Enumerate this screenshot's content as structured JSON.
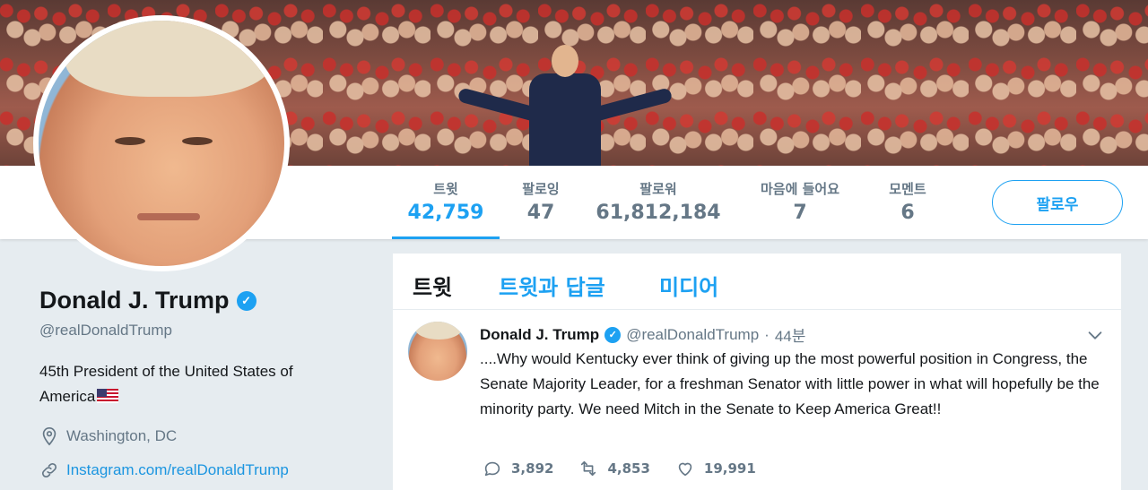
{
  "profile": {
    "name": "Donald J. Trump",
    "handle": "@realDonaldTrump",
    "bio": "45th President of the United States of America",
    "location": "Washington, DC",
    "link": "Instagram.com/realDonaldTrump",
    "verified_mark": "✓"
  },
  "nav": {
    "stats": [
      {
        "label": "트윗",
        "value": "42,759"
      },
      {
        "label": "팔로잉",
        "value": "47"
      },
      {
        "label": "팔로워",
        "value": "61,812,184"
      },
      {
        "label": "마음에 들어요",
        "value": "7"
      },
      {
        "label": "모멘트",
        "value": "6"
      }
    ],
    "follow_label": "팔로우"
  },
  "timeline": {
    "tabs": [
      {
        "label": "트윗"
      },
      {
        "label": "트윗과 답글"
      },
      {
        "label": "미디어"
      }
    ]
  },
  "tweet": {
    "name": "Donald J. Trump",
    "handle": "@realDonaldTrump",
    "separator": "·",
    "time": "44분",
    "text": "....Why would Kentucky ever think of giving up the most powerful position in Congress, the Senate Majority Leader, for a freshman Senator with little power in what will hopefully be the minority party. We need Mitch in the Senate to Keep America Great!!",
    "replies": "3,892",
    "retweets": "4,853",
    "likes": "19,991"
  },
  "colors": {
    "accent": "#1da1f2",
    "link": "#1b95e0",
    "muted": "#657786",
    "background": "#e6ecf0"
  },
  "icons": [
    "location-pin-icon",
    "link-icon",
    "verified-badge-icon",
    "chevron-down-icon",
    "reply-icon",
    "retweet-icon",
    "like-icon"
  ]
}
